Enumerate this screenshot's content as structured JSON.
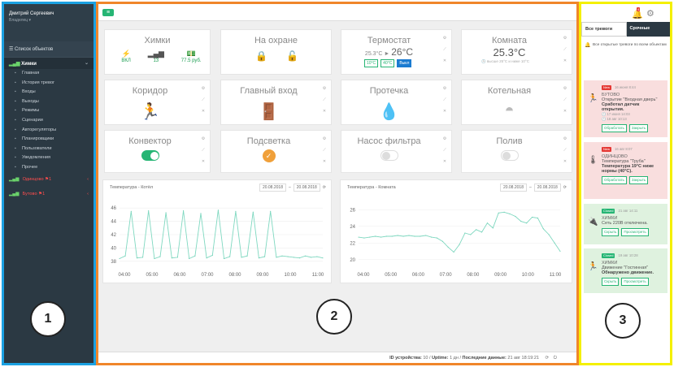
{
  "sidebar": {
    "user_name": "Дмитрий Сергеевич",
    "user_role": "Владелец ▾",
    "objects_list": "☰ Список объектов",
    "group": "Химки",
    "items": [
      {
        "label": "Главная",
        "icon": "dashboard-icon"
      },
      {
        "label": "История тревог",
        "icon": "bell-icon"
      },
      {
        "label": "Входы",
        "icon": "input-icon"
      },
      {
        "label": "Выходы",
        "icon": "output-icon"
      },
      {
        "label": "Режимы",
        "icon": "mode-icon"
      },
      {
        "label": "Сценарии",
        "icon": "scenario-icon"
      },
      {
        "label": "Авторегуляторы",
        "icon": "regulator-icon"
      },
      {
        "label": "Планировщики",
        "icon": "calendar-icon"
      },
      {
        "label": "Пользователи",
        "icon": "users-icon"
      },
      {
        "label": "Уведомления",
        "icon": "notification-icon"
      },
      {
        "label": "Прочее",
        "icon": "other-icon"
      }
    ],
    "alarm_objects": [
      {
        "label": "Одинцово",
        "count": "1"
      },
      {
        "label": "Бутово",
        "count": "1"
      }
    ]
  },
  "annotations": [
    "1",
    "2",
    "3"
  ],
  "tiles": {
    "khimki": {
      "title": "Химки",
      "stats": [
        {
          "sym": "⚡",
          "val": "ВКЛ"
        },
        {
          "sym": "▂▄▆",
          "val": "13"
        },
        {
          "sym": "💵",
          "val": "77.5 руб."
        }
      ]
    },
    "guard": {
      "title": "На охране"
    },
    "thermostat": {
      "title": "Термостат",
      "current": "25.3°C",
      "arrow": "►",
      "target": "26°C",
      "btn1": "10°C",
      "btn2": "40°C",
      "btn3": "Выкл"
    },
    "room": {
      "title": "Комната",
      "temp": "25.3°C",
      "sub": "🕓 высше 25°C и ниже 10°C"
    },
    "corridor": {
      "title": "Коридор"
    },
    "entrance": {
      "title": "Главный вход"
    },
    "leak": {
      "title": "Протечка"
    },
    "boiler": {
      "title": "Котельная"
    },
    "convector": {
      "title": "Конвектор"
    },
    "light": {
      "title": "Подсветка"
    },
    "pump": {
      "title": "Насос фильтра"
    },
    "watering": {
      "title": "Полив"
    }
  },
  "chart_data": [
    {
      "type": "line",
      "title": "Температура - Котёл",
      "date_from": "20.08.2018",
      "date_to": "20.08.2018",
      "x": [
        "04:00",
        "05:00",
        "06:00",
        "07:00",
        "08:00",
        "09:00",
        "10:00",
        "11:00"
      ],
      "yticks": [
        38,
        40,
        42,
        44,
        46
      ],
      "ylim": [
        37,
        47
      ],
      "series": [
        {
          "values": [
            38.4,
            38.8,
            45.5,
            38.5,
            38.6,
            45.6,
            38.4,
            38.7,
            45.3,
            38.5,
            38.6,
            45.6,
            38.4,
            38.8,
            45.2,
            38.5,
            38.9,
            45.7,
            38.4,
            38.7,
            45.5,
            38.6,
            38.8,
            45.4,
            38.5,
            38.7,
            45.5,
            38.6,
            38.8,
            38.7,
            38.6,
            38.5,
            38.8,
            38.6,
            38.7,
            38.5
          ]
        }
      ],
      "xlim": [
        0,
        35
      ]
    },
    {
      "type": "line",
      "title": "Температура - Комната",
      "date_from": "20.08.2018",
      "date_to": "20.08.2018",
      "x": [
        "04:00",
        "05:00",
        "06:00",
        "07:00",
        "08:00",
        "09:00",
        "10:00",
        "11:00"
      ],
      "yticks": [
        20,
        22,
        24,
        26
      ],
      "ylim": [
        19,
        27
      ],
      "series": [
        {
          "values": [
            22.7,
            22.6,
            22.7,
            22.8,
            22.7,
            22.8,
            22.8,
            22.9,
            22.8,
            22.9,
            22.8,
            22.8,
            22.9,
            22.7,
            22.6,
            22.2,
            21.5,
            20.9,
            21.8,
            23.2,
            23.0,
            23.6,
            23.3,
            24.4,
            23.8,
            25.6,
            25.7,
            25.5,
            25.2,
            24.6,
            24.4,
            25.1,
            25.0,
            23.7,
            23.0,
            22.0,
            21.0
          ]
        }
      ],
      "xlim": [
        0,
        36
      ]
    }
  ],
  "footer": {
    "device_label": "ID устройства:",
    "device_val": " 10  /",
    "uptime_label": "Uptime:",
    "uptime_val": " 1 дн  /",
    "last_label": "Последние данные:",
    "last_val": " 21 авг 18:19:21"
  },
  "alerts": {
    "bell_count": "4",
    "tab_all": "Все тревоги",
    "tab_urgent": "Срочные",
    "all_open": "Все открытые тревоги по всем объектам",
    "cards": [
      {
        "tag": "New",
        "time": "16 июня 8:44",
        "object": "БУТОВО",
        "text": "Открытие \"Входная дверь\"",
        "bold": "Сработал датчик открытия.",
        "t1": "🕓 17 июня 14:03",
        "t2": "🕓 18 авг 10:13",
        "a1": "Обработать",
        "a2": "Закрыть"
      },
      {
        "tag": "New",
        "time": "16 авг 8:07",
        "object": "ОДИНЦОВО",
        "text": "Температура \"Труба\"",
        "bold": "Температура 19°C ниже нормы (40°C).",
        "a1": "Обработать",
        "a2": "Закрыть"
      },
      {
        "tag": "Closed",
        "time": "21 авг 14:11",
        "object": "ХИМКИ",
        "text": "Сеть 220В отключена.",
        "a1": "Скрыть",
        "a2": "Просмотреть"
      },
      {
        "tag": "Closed",
        "time": "19 авг 10:28",
        "object": "ХИМКИ",
        "text": "Движение \"Гостинная\"",
        "bold": "Обнаружено движение.",
        "a1": "Скрыть",
        "a2": "Просмотреть"
      }
    ]
  }
}
